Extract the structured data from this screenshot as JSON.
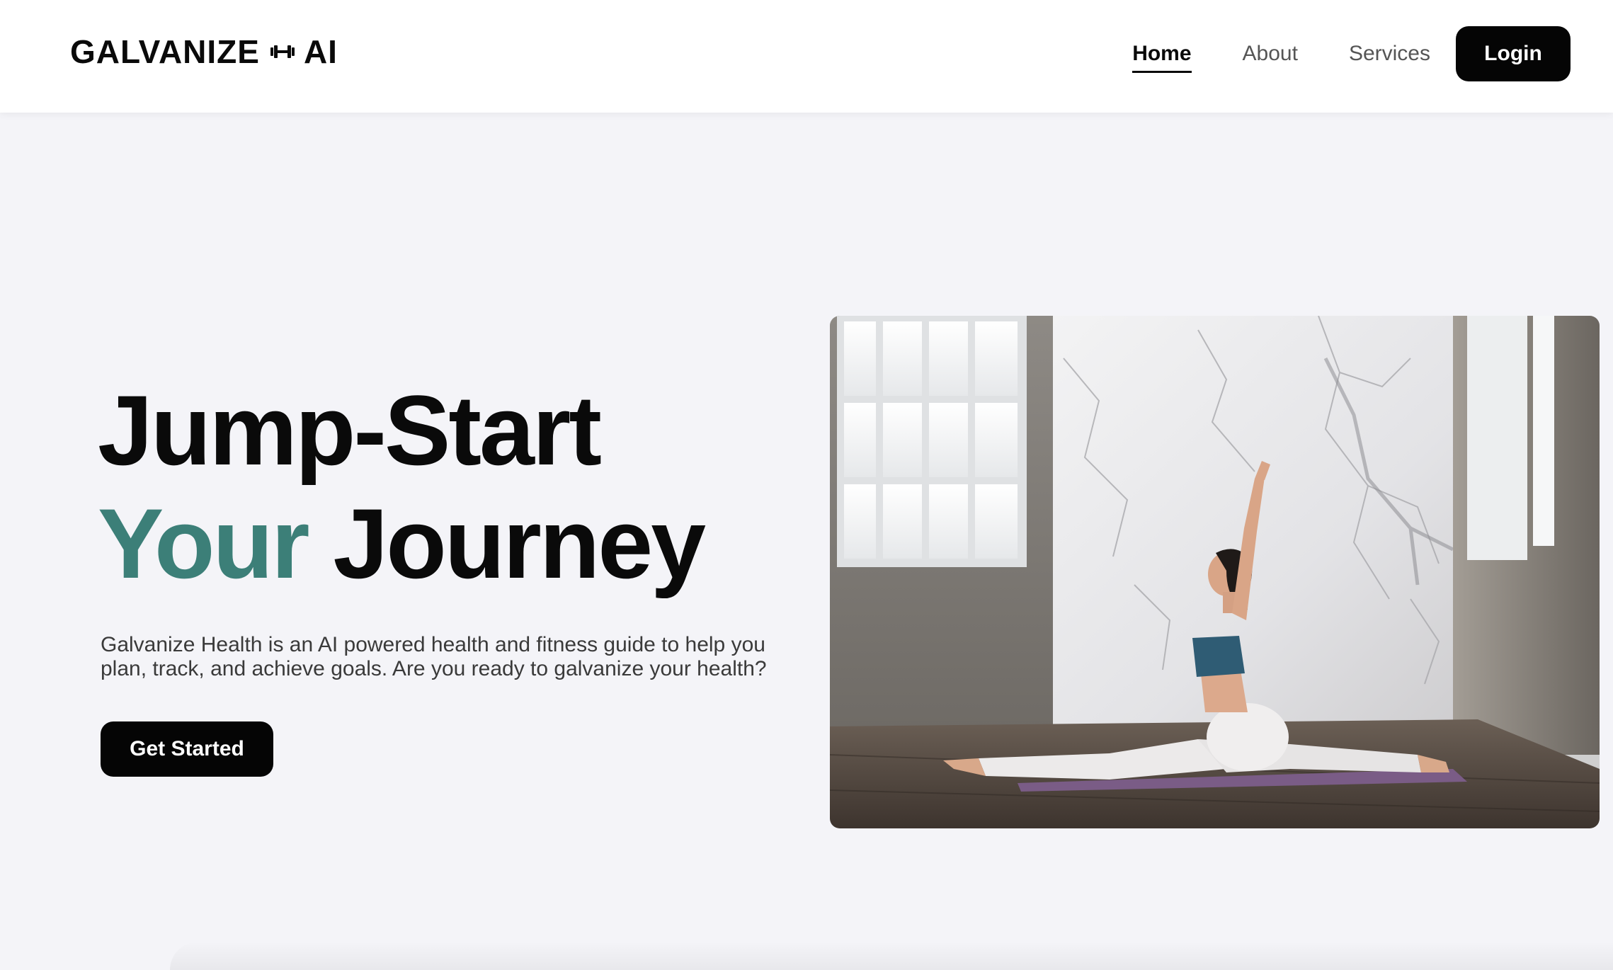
{
  "header": {
    "logo": {
      "text_left": "GALVANIZE",
      "icon": "dumbbell-icon",
      "text_right": "AI"
    },
    "nav": [
      {
        "label": "Home",
        "active": true
      },
      {
        "label": "About",
        "active": false
      },
      {
        "label": "Services",
        "active": false
      }
    ],
    "login_label": "Login"
  },
  "hero": {
    "title_line1": "Jump-Start",
    "title_line2_accent": "Your",
    "title_line2_rest": "Journey",
    "description": "Galvanize Health is an AI powered health and fitness guide to help you plan, track, and achieve goals. Are you ready to galvanize your health?",
    "cta_label": "Get Started",
    "image_subject": "woman doing a yoga split stretch on a mat in a bright studio with marble wall and tall windows"
  },
  "colors": {
    "accent": "#3c7f78",
    "button_bg": "#050505",
    "page_bg": "#f4f4f8",
    "header_bg": "#ffffff"
  }
}
